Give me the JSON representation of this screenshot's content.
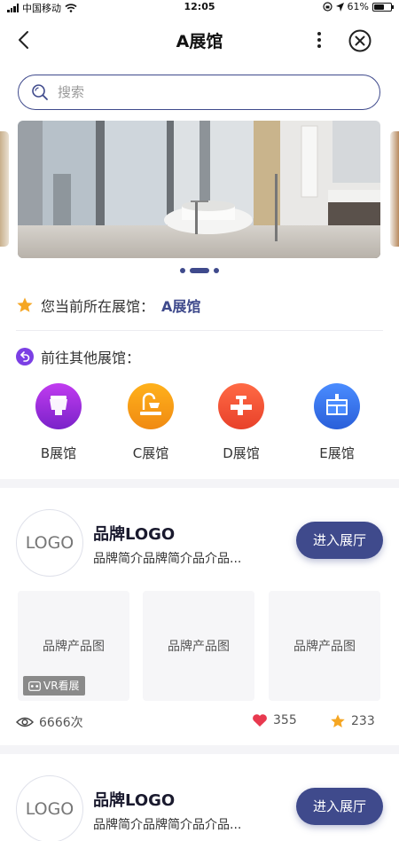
{
  "status_bar": {
    "carrier": "中国移动",
    "time": "12:05",
    "battery": "61%",
    "battery_level": 0.61
  },
  "nav": {
    "title": "A展馆"
  },
  "search": {
    "placeholder": "搜索"
  },
  "banner": {
    "slide_count": 3,
    "active_index": 1
  },
  "current_hall": {
    "label": "您当前所在展馆：",
    "name": "A展馆"
  },
  "other_halls": {
    "label": "前往其他展馆：",
    "items": [
      {
        "label": "B展馆",
        "color": "#8a2be2"
      },
      {
        "label": "C展馆",
        "color": "#f5a623"
      },
      {
        "label": "D展馆",
        "color": "#f0522f"
      },
      {
        "label": "E展馆",
        "color": "#2f6ee6"
      }
    ]
  },
  "brands": [
    {
      "logo": "LOGO",
      "name": "品牌LOGO",
      "desc": "品牌简介品牌简介品介品...",
      "enter_label": "进入展厅",
      "products": [
        "品牌产品图",
        "品牌产品图",
        "品牌产品图"
      ],
      "vr_label": "VR看展",
      "views": "6666次",
      "likes": "355",
      "stars": "233"
    },
    {
      "logo": "LOGO",
      "name": "品牌LOGO",
      "desc": "品牌简介品牌简介品介品...",
      "enter_label": "进入展厅"
    }
  ],
  "colors": {
    "accent": "#3f4a8c",
    "heart": "#e8394f",
    "star": "#f5a623"
  }
}
